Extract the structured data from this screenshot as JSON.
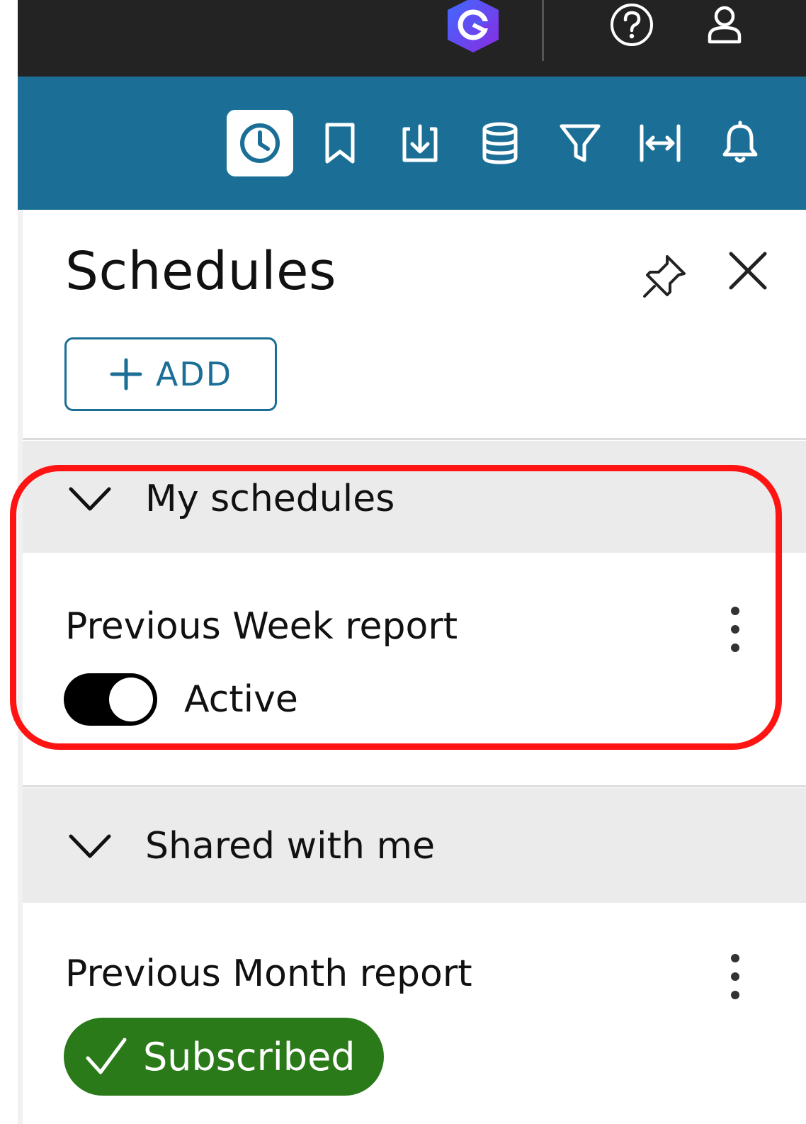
{
  "topbar": {
    "icons": [
      "app-logo-icon",
      "help-icon",
      "user-icon"
    ]
  },
  "toolbar": {
    "icons": [
      "schedule-clock-icon",
      "bookmark-icon",
      "download-icon",
      "dataset-icon",
      "filter-icon",
      "fit-width-icon",
      "bell-icon"
    ],
    "active": "schedule-clock-icon",
    "accent_color": "#1b6f96"
  },
  "panel": {
    "title": "Schedules",
    "add_label": "ADD"
  },
  "sections": {
    "my_schedules": {
      "label": "My schedules",
      "items": [
        {
          "name": "Previous Week report",
          "status": "Active",
          "enabled": true
        }
      ]
    },
    "shared_with_me": {
      "label": "Shared with me",
      "items": [
        {
          "name": "Previous Month report",
          "badge": "Subscribed",
          "badge_color": "#2b7a1a"
        }
      ]
    }
  },
  "highlight_color": "#ff1414"
}
